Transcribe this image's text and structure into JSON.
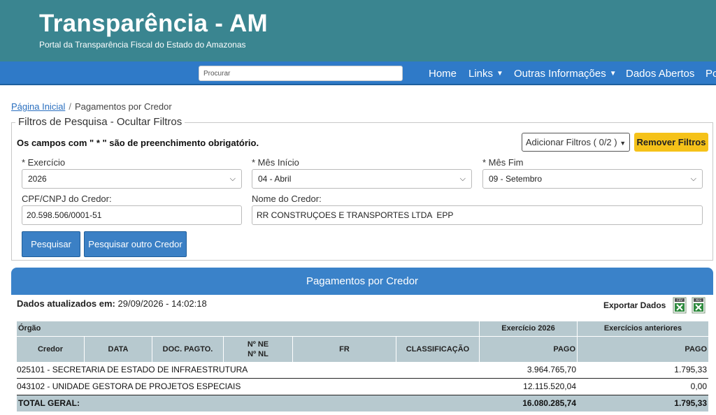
{
  "header": {
    "title": "Transparência - AM",
    "subtitle": "Portal da Transparência Fiscal do Estado do Amazonas"
  },
  "nav": {
    "search_placeholder": "Procurar",
    "items": [
      {
        "label": "Home"
      },
      {
        "label": "Links"
      },
      {
        "label": "Outras Informações"
      },
      {
        "label": "Dados Abertos"
      },
      {
        "label": "Po"
      }
    ]
  },
  "breadcrumb": {
    "home": "Página Inicial",
    "separator": "/",
    "current": "Pagamentos por Credor"
  },
  "filters": {
    "legend": "Filtros de Pesquisa - Ocultar Filtros",
    "required_note": "Os campos com \" * \" são de preenchimento obrigatório.",
    "add_filters_label": "Adicionar Filtros ( 0/2 )",
    "remove_filters_label": "Remover Filtros",
    "exercicio_label": "* Exercício",
    "exercicio_value": "2026",
    "mes_inicio_label": "* Mês Início",
    "mes_inicio_value": "04 - Abril",
    "mes_fim_label": "* Mês Fim",
    "mes_fim_value": "09 - Setembro",
    "cpf_label": "CPF/CNPJ do Credor:",
    "cpf_value": "20.598.506/0001-51",
    "nome_label": "Nome do Credor:",
    "nome_value": "RR CONSTRUÇOES E TRANSPORTES LTDA  EPP",
    "search_button": "Pesquisar",
    "search_other_button": "Pesquisar outro Credor"
  },
  "results": {
    "title": "Pagamentos por Credor",
    "updated_label": "Dados atualizados em:",
    "updated_value": "29/09/2026 - 14:02:18",
    "export_label": "Exportar Dados",
    "export_icons": [
      "csv-file-icon",
      "xls-file-icon"
    ],
    "table": {
      "group_header": "Órgão",
      "exercicio_header": "Exercício 2026",
      "anteriores_header": "Exercícios anteriores",
      "columns": [
        "Credor",
        "DATA",
        "DOC. PAGTO.",
        "Nº NE",
        "Nº NL",
        "FR",
        "CLASSIFICAÇÃO",
        "PAGO",
        "PAGO"
      ],
      "rows": [
        {
          "orgao": "025101 - SECRETARIA DE ESTADO DE INFRAESTRUTURA",
          "pago": "3.964.765,70",
          "pago_ant": "1.795,33"
        },
        {
          "orgao": "043102 - UNIDADE GESTORA DE PROJETOS ESPECIAIS",
          "pago": "12.115.520,04",
          "pago_ant": "0,00"
        }
      ],
      "total_label": "TOTAL GERAL:",
      "total_pago": "16.080.285,74",
      "total_pago_ant": "1.795,33"
    }
  },
  "colors": {
    "header_bg": "#3a8590",
    "nav_bg": "#2f7ac8",
    "accent_yellow": "#f5c219",
    "table_header_bg": "#b7c9cf"
  }
}
